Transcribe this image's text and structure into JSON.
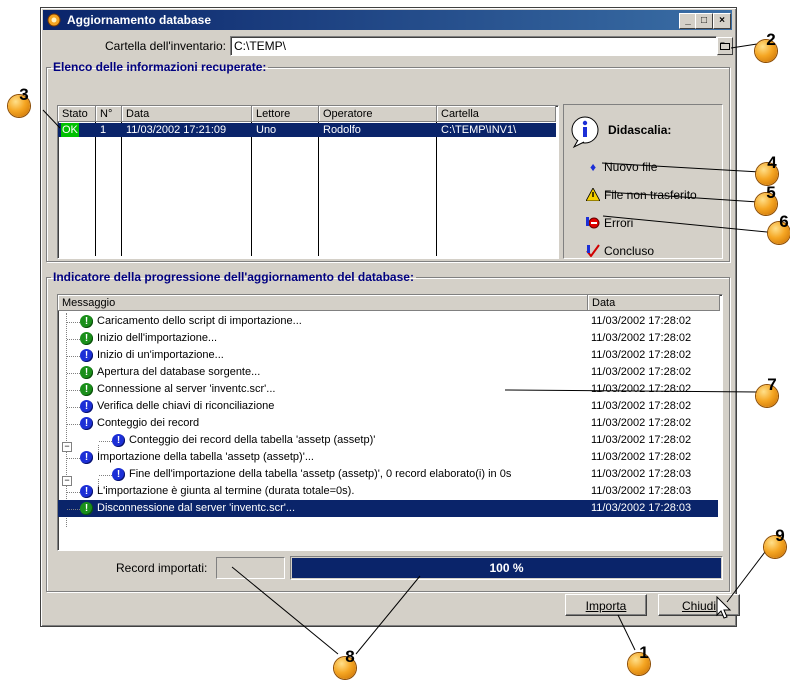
{
  "window": {
    "title": "Aggiornamento database",
    "buttons": {
      "minimize": "_",
      "maximize": "□",
      "close": "×"
    }
  },
  "folder": {
    "label": "Cartella dell'inventario:",
    "value": "C:\\TEMP\\"
  },
  "recovered": {
    "legend": "Elenco delle informazioni recuperate:",
    "columns": [
      "Stato",
      "N°",
      "Data",
      "Lettore",
      "Operatore",
      "Cartella"
    ],
    "rows": [
      {
        "stato": "OK",
        "n": "1",
        "data": "11/03/2002 17:21:09",
        "lettore": "Uno",
        "operatore": "Rodolfo",
        "cartella": "C:\\TEMP\\INV1\\"
      }
    ]
  },
  "caption": {
    "title": "Didascalia:",
    "items": [
      "Nuovo file",
      "File non trasferito",
      "Errori",
      "Concluso"
    ]
  },
  "progress": {
    "legend": "Indicatore della progressione dell'aggiornamento del database:",
    "columns": [
      "Messaggio",
      "Data"
    ],
    "messages": [
      {
        "text": "Caricamento dello script di importazione...",
        "date": "11/03/2002 17:28:02",
        "color": "green",
        "level": 0
      },
      {
        "text": "Inizio dell'importazione...",
        "date": "11/03/2002 17:28:02",
        "color": "green",
        "level": 0
      },
      {
        "text": "Inizio di un'importazione...",
        "date": "11/03/2002 17:28:02",
        "color": "blue",
        "level": 0
      },
      {
        "text": "Apertura del database sorgente...",
        "date": "11/03/2002 17:28:02",
        "color": "green",
        "level": 0
      },
      {
        "text": "Connessione al server 'inventc.scr'...",
        "date": "11/03/2002 17:28:02",
        "color": "green",
        "level": 0
      },
      {
        "text": "Verifica delle chiavi di riconciliazione",
        "date": "11/03/2002 17:28:02",
        "color": "blue",
        "level": 0
      },
      {
        "text": "Conteggio dei record",
        "date": "11/03/2002 17:28:02",
        "color": "blue",
        "level": 0
      },
      {
        "text": "Conteggio dei record della tabella 'assetp (assetp)'",
        "date": "11/03/2002 17:28:02",
        "color": "blue",
        "level": 1
      },
      {
        "text": "Importazione della tabella 'assetp (assetp)'...",
        "date": "11/03/2002 17:28:02",
        "color": "blue",
        "level": 0
      },
      {
        "text": "Fine dell'importazione della tabella 'assetp (assetp)', 0 record elaborato(i) in 0s",
        "date": "11/03/2002 17:28:03",
        "color": "blue",
        "level": 1
      },
      {
        "text": "L'importazione è giunta al termine (durata totale=0s).",
        "date": "11/03/2002 17:28:03",
        "color": "blue",
        "level": 0
      },
      {
        "text": "Disconnessione dal server 'inventc.scr'...",
        "date": "11/03/2002 17:28:03",
        "color": "green",
        "level": 0
      }
    ],
    "records_label": "Record importati:",
    "percent_text": "100 %",
    "percent_value": 100
  },
  "footer": {
    "import_label": "Importa",
    "close_label": "Chiudi"
  },
  "callouts": [
    "1",
    "2",
    "3",
    "4",
    "5",
    "6",
    "7",
    "8",
    "9"
  ],
  "colors": {
    "title_start": "#0a246a",
    "title_end": "#3a6ea5",
    "selection": "#0a246a",
    "status_ok": "#00c000",
    "progress_fill": "#0a246a",
    "callout": "#f5a623",
    "icon_green": "#1a8f1a",
    "icon_blue": "#1c2fd6"
  },
  "icons": {
    "app": "gear-database-icon",
    "folder_browse": "folder-icon",
    "info": "info-icon",
    "new_file": "new-file-icon",
    "not_transferred": "warning-icon",
    "errors": "error-icon",
    "done": "checkmark-icon"
  }
}
